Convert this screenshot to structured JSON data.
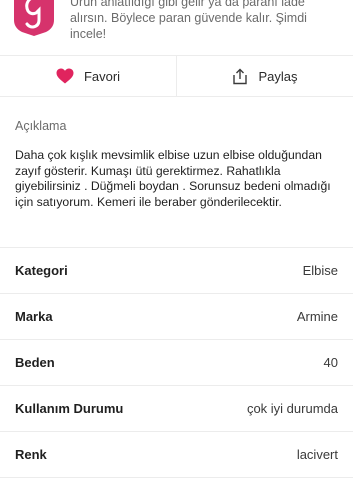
{
  "banner": {
    "logo_icon": "shield-g-logo-icon",
    "lines": [
      "Ürün anlatıldığı gibi gelir ya da paranı iade",
      "alırsın. Böylece paran güvende kalır. Şimdi",
      "incele!"
    ]
  },
  "actions": {
    "favorite_label": "Favori",
    "favorite_icon": "heart-icon",
    "share_label": "Paylaş",
    "share_icon": "share-icon"
  },
  "description": {
    "heading": "Açıklama",
    "text": "Daha çok kışlık mevsimlik elbise uzun elbise olduğundan zayıf gösterir. Kumaşı ütü gerektirmez. Rahatlıkla giyebilirsiniz . Düğmeli boydan . Sorunsuz bedeni olmadığı için satıyorum. Kemeri ile beraber gönderilecektir."
  },
  "specs": [
    {
      "label": "Kategori",
      "value": "Elbise"
    },
    {
      "label": "Marka",
      "value": "Armine"
    },
    {
      "label": "Beden",
      "value": "40"
    },
    {
      "label": "Kullanım Durumu",
      "value": "çok iyi durumda"
    },
    {
      "label": "Renk",
      "value": "lacivert"
    }
  ],
  "colors": {
    "accent": "#e0245e",
    "text": "#1f1f1f",
    "muted": "#6b6b6b",
    "divider": "#ececec"
  }
}
